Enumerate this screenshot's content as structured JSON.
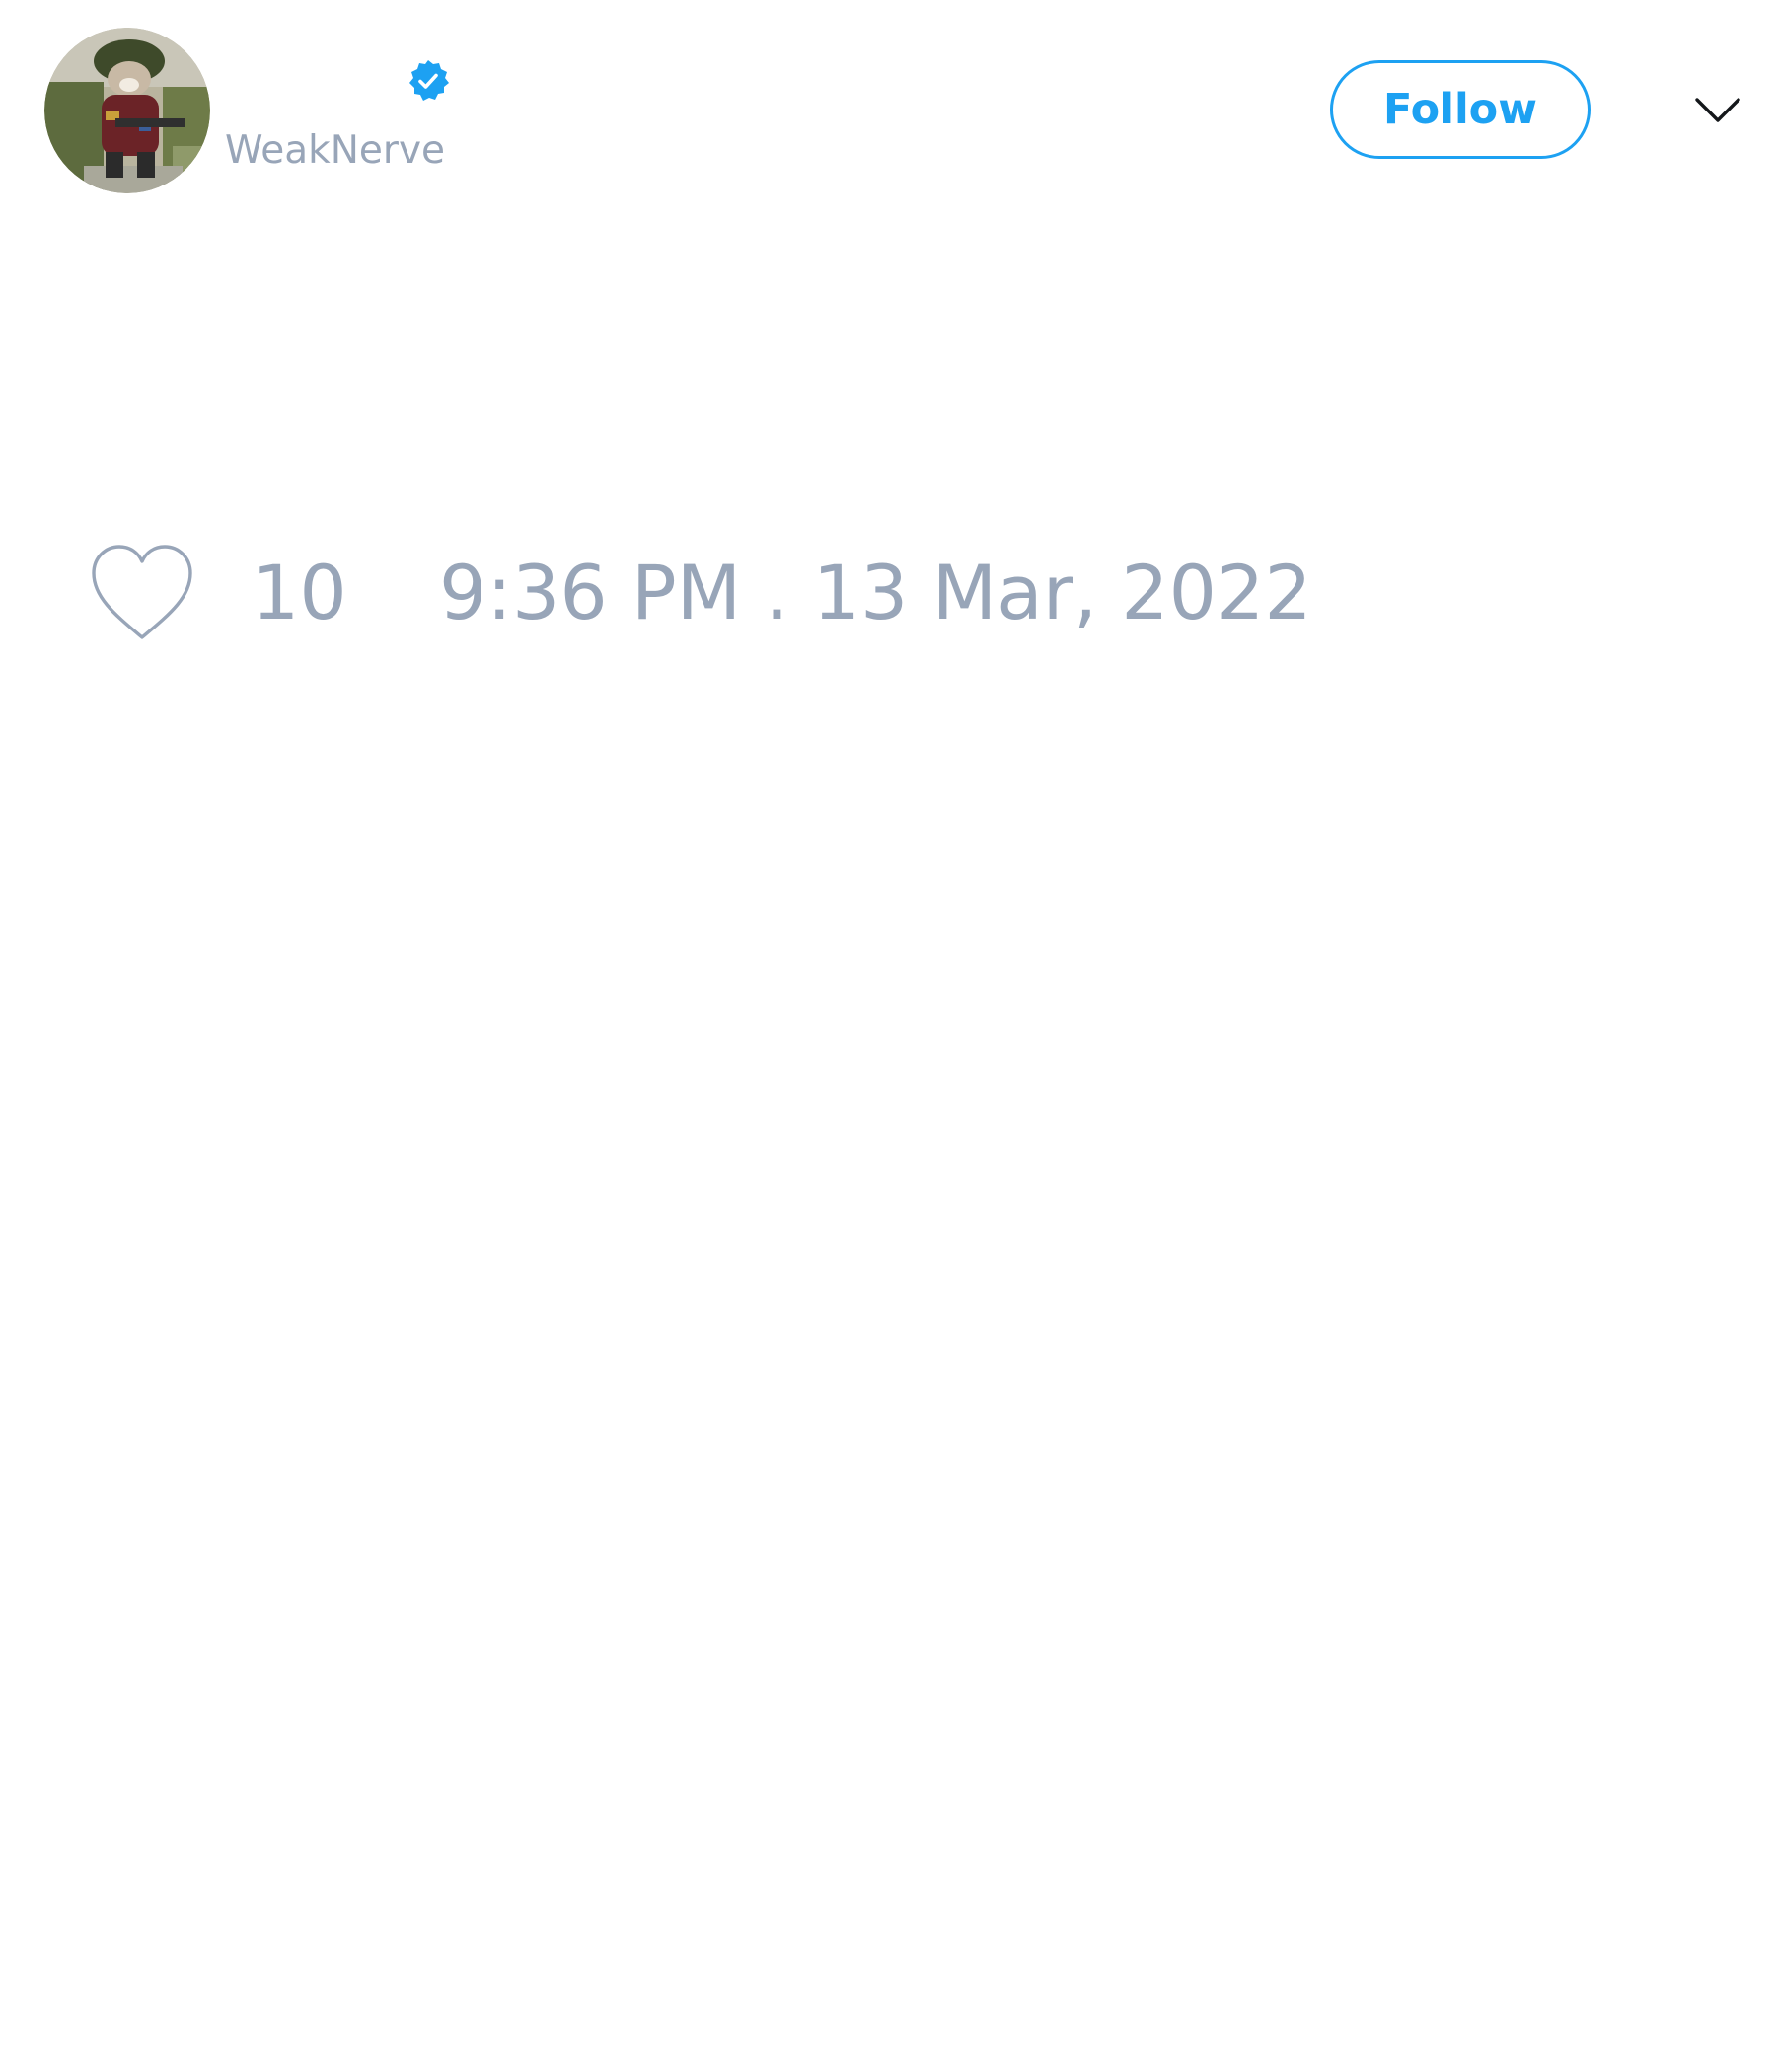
{
  "tweet": {
    "author": {
      "display_name": "",
      "handle": "WeakNerve",
      "verified": true,
      "avatar_icon": "avatar-photo",
      "verified_icon": "verified-badge-icon"
    },
    "follow_button": {
      "label": "Follow"
    },
    "menu_icon": "chevron-down-icon",
    "like_icon": "heart-icon",
    "like_count": "10",
    "timestamp": "9:36 PM . 13 Mar, 2022"
  },
  "colors": {
    "accent": "#1da1f2",
    "muted_text": "#98a5b8",
    "background": "#ffffff"
  }
}
